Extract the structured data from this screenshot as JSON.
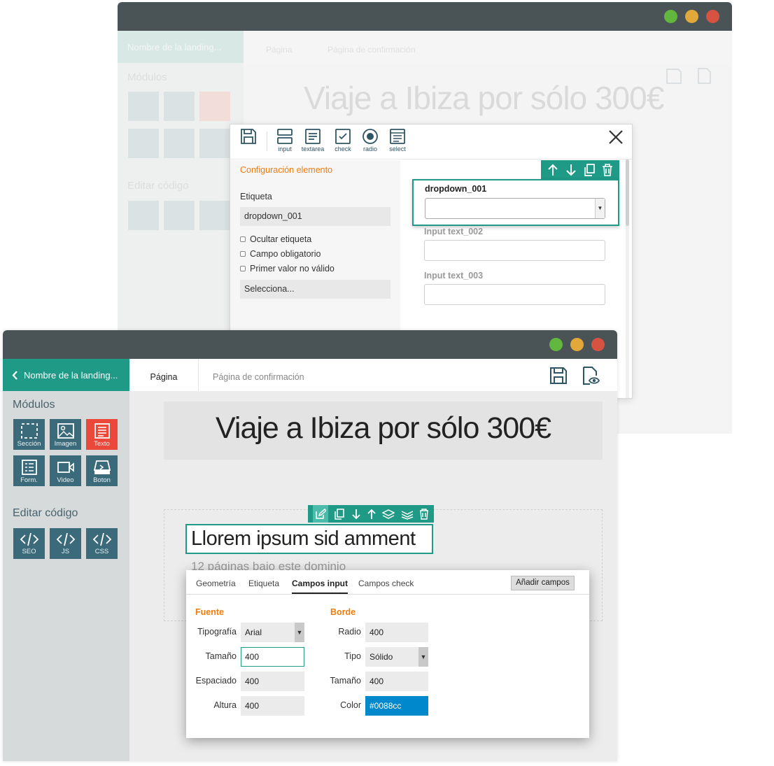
{
  "colors": {
    "teal": "#1f9a86",
    "dark": "#4a5457",
    "orange": "#f07c0f",
    "red": "#e9483a",
    "tile": "#3b6a7a",
    "blue": "#0088cc",
    "dot_green": "#62b73e",
    "dot_yellow": "#e2a83a",
    "dot_red": "#d75341"
  },
  "back_window": {
    "back_label": "Nombre de la landing...",
    "tab_page": "Página",
    "tab_confirm": "Página de confirmación",
    "title": "Viaje a Ibiza por sólo 300€",
    "modules_title": "Módulos",
    "code_title": "Editar código"
  },
  "form_builder": {
    "toolbar": [
      {
        "icon": "save-icon",
        "label": ""
      },
      {
        "icon": "input-icon",
        "label": "input"
      },
      {
        "icon": "textarea-icon",
        "label": "textarea"
      },
      {
        "icon": "check-icon",
        "label": "check"
      },
      {
        "icon": "radio-icon",
        "label": "radio"
      },
      {
        "icon": "select-icon",
        "label": "select"
      }
    ],
    "config": {
      "heading": "Configuración elemento",
      "label_title": "Etiqueta",
      "label_value": "dropdown_001",
      "checkboxes": [
        "Ocultar etiqueta",
        "Campo obligatorio",
        "Primer valor no válido"
      ],
      "select_value": "Selecciona..."
    },
    "preview": {
      "dropdown_label": "dropdown_001",
      "inputs": [
        "Input text_002",
        "Input text_003"
      ]
    }
  },
  "front_window": {
    "back_label": "Nombre de la landing...",
    "tab_page": "Página",
    "tab_confirm": "Página de  confirmación",
    "modules_title": "Módulos",
    "modules": [
      {
        "icon": "section-icon",
        "label": "Sección"
      },
      {
        "icon": "image-icon",
        "label": "Imagen"
      },
      {
        "icon": "text-icon",
        "label": "Texto"
      },
      {
        "icon": "form-icon",
        "label": "Form."
      },
      {
        "icon": "video-icon",
        "label": "Video"
      },
      {
        "icon": "button-icon",
        "label": "Boton"
      }
    ],
    "code_title": "Editar código",
    "code_modules": [
      "SEO",
      "JS",
      "CSS"
    ],
    "hero_title": "Viaje a Ibiza por sólo 300€",
    "text_block": "Llorem ipsum sid amment",
    "subtext": "12 páginas bajo este dominio"
  },
  "props_panel": {
    "tabs": [
      "Geometría",
      "Etiqueta",
      "Campos input",
      "Campos check"
    ],
    "active_tab": "Campos input",
    "add_button": "Añadir campos",
    "fuente": {
      "heading": "Fuente",
      "rows": [
        {
          "label": "Tipografía",
          "value": "Arial"
        },
        {
          "label": "Tamaño",
          "value": "400"
        },
        {
          "label": "Espaciado",
          "value": "400"
        },
        {
          "label": "Altura",
          "value": "400"
        }
      ]
    },
    "borde": {
      "heading": "Borde",
      "rows": [
        {
          "label": "Radio",
          "value": "400"
        },
        {
          "label": "Tipo",
          "value": "Sólido"
        },
        {
          "label": "Tamaño",
          "value": "400"
        },
        {
          "label": "Color",
          "value": "#0088cc"
        }
      ]
    }
  }
}
